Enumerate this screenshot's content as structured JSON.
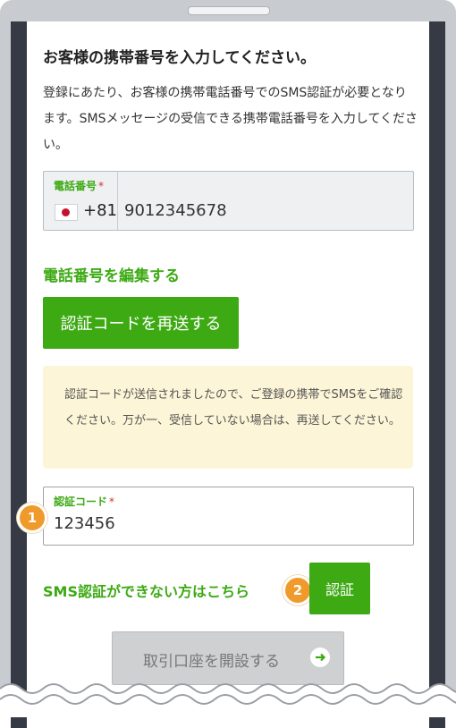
{
  "page": {
    "heading": "お客様の携帯番号を入力してください。",
    "intro": "登録にあたり、お客様の携帯電話番号でのSMS認証が必要となります。SMSメッセージの受信できる携帯電話番号を入力してください。"
  },
  "phone_field": {
    "label": "電話番号",
    "required_mark": "*",
    "country_flag": "japan-flag-icon",
    "country_code": "+81",
    "value": "9012345678"
  },
  "edit_link": "電話番号を編集する",
  "resend_button": "認証コードを再送する",
  "notice": "認証コードが送信されましたので、ご登録の携帯でSMSをご確認ください。万が一、受信していない場合は、再送してください。",
  "code_field": {
    "label": "認証コード",
    "required_mark": "*",
    "value": "123456"
  },
  "badges": [
    "1",
    "2"
  ],
  "sms_help_link": "SMS認証ができない方はこちら",
  "verify_button": "認証",
  "open_account_button": {
    "label": "取引口座を開設する",
    "icon": "arrow-right-icon"
  },
  "colors": {
    "accent": "#3daa14",
    "badge": "#f09a2b",
    "notice_bg": "#fdf5d7",
    "disabled_bg": "#cfd0d1"
  }
}
